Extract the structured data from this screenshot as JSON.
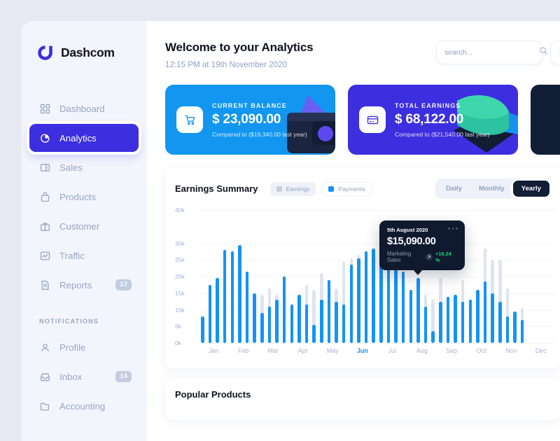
{
  "brand": {
    "name": "Dashcom",
    "logo_icon": "dashcom-logo-icon",
    "color": "#3d2ee0"
  },
  "sidebar": {
    "items": [
      {
        "label": "Dashboard",
        "icon": "grid-icon",
        "badge": null,
        "active": false
      },
      {
        "label": "Analytics",
        "icon": "pie-chart-icon",
        "badge": null,
        "active": true
      },
      {
        "label": "Sales",
        "icon": "wallet-icon",
        "badge": null,
        "active": false
      },
      {
        "label": "Products",
        "icon": "bag-icon",
        "badge": null,
        "active": false
      },
      {
        "label": "Customer",
        "icon": "briefcase-icon",
        "badge": null,
        "active": false
      },
      {
        "label": "Traffic",
        "icon": "chart-line-icon",
        "badge": null,
        "active": false
      },
      {
        "label": "Reports",
        "icon": "document-icon",
        "badge": "17",
        "active": false
      }
    ],
    "section_label": "NOTIFICATIONS",
    "notification_items": [
      {
        "label": "Profile",
        "icon": "user-icon",
        "badge": null
      },
      {
        "label": "Inbox",
        "icon": "inbox-icon",
        "badge": "14"
      },
      {
        "label": "Accounting",
        "icon": "folder-icon",
        "badge": null
      }
    ]
  },
  "header": {
    "title": "Welcome to your Analytics",
    "subtitle": "12:15 PM at 19th November 2020",
    "search_placeholder": "search...",
    "search_value": "",
    "search_icon": "search-icon",
    "extra_button_icon": "plus-icon"
  },
  "cards": [
    {
      "label": "CURRENT BALANCE",
      "value": "$ 23,090.00",
      "sub": "Compared to ($19,340.00 last year)",
      "icon": "cart-icon",
      "theme": "blue",
      "color": "#1296f0"
    },
    {
      "label": "TOTAL EARNINGS",
      "value": "$ 68,122.00",
      "sub": "Compared to ($21,540.00 last year)",
      "icon": "credit-card-icon",
      "theme": "indigo",
      "color": "#3d2ee0"
    },
    {
      "label": "",
      "value": "",
      "sub": "",
      "icon": "diamond-icon",
      "theme": "dark",
      "color": "#121e36"
    }
  ],
  "earnings_panel": {
    "title": "Earnings Summary",
    "legend": [
      {
        "label": "Earnings",
        "color": "#c7cfde"
      },
      {
        "label": "Payments",
        "color": "#1593f5"
      }
    ],
    "ranges": [
      {
        "label": "Daily",
        "active": false
      },
      {
        "label": "Monthly",
        "active": false
      },
      {
        "label": "Yearly",
        "active": true
      }
    ],
    "tooltip": {
      "date": "5th August 2020",
      "value": "$15,090.00",
      "label": "Marketing Sales",
      "percent": "+16.24 %",
      "percent_color": "#24d07a",
      "arrow_icon": "arrow-up-right-icon"
    }
  },
  "popular_panel": {
    "title": "Popular Products"
  },
  "chart_data": {
    "type": "bar",
    "title": "Earnings Summary",
    "xlabel": "",
    "ylabel": "",
    "ylim": [
      0,
      40000
    ],
    "ytick_labels": [
      "0k",
      "5k",
      "10k",
      "15k",
      "20k",
      "25k",
      "30k",
      "40k"
    ],
    "ytick_values": [
      0,
      5000,
      10000,
      15000,
      20000,
      25000,
      30000,
      40000
    ],
    "categories": [
      "Jan",
      "Feb",
      "Mar",
      "Apr",
      "May",
      "Jun",
      "Jul",
      "Aug",
      "Sep",
      "Oct",
      "Nov",
      "Dec"
    ],
    "highlighted_category": "Jun",
    "grid": true,
    "legend_position": "top",
    "bars_per_category": 4,
    "series": [
      {
        "name": "Payments",
        "color": "#1593f5",
        "values": [
          8000,
          17500,
          19500,
          28000,
          27500,
          29500,
          21500,
          15000,
          9000,
          11000,
          13000,
          20000,
          11500,
          14500,
          11500,
          5500,
          13000,
          19000,
          12500,
          11500,
          23500,
          25500,
          27500,
          28500,
          28000,
          28000,
          28000,
          21500,
          16000,
          19500,
          11000,
          3500,
          12500,
          14000,
          14500,
          12500,
          13000,
          16000,
          18500,
          15000,
          12500,
          8000,
          9500,
          7000,
          0,
          0,
          0,
          0
        ]
      },
      {
        "name": "Earnings",
        "color": "#dfe5ee",
        "values": [
          8000,
          17500,
          19500,
          28000,
          27500,
          29500,
          21500,
          15000,
          14500,
          16500,
          14500,
          20000,
          11500,
          14500,
          17500,
          16000,
          21000,
          19000,
          16500,
          24500,
          25500,
          26500,
          27500,
          28500,
          28000,
          28000,
          28000,
          21500,
          16000,
          19500,
          14500,
          13000,
          19500,
          14000,
          14500,
          19000,
          13000,
          16000,
          28500,
          25000,
          25000,
          16500,
          9500,
          10500,
          0,
          0,
          0,
          0
        ]
      }
    ]
  }
}
